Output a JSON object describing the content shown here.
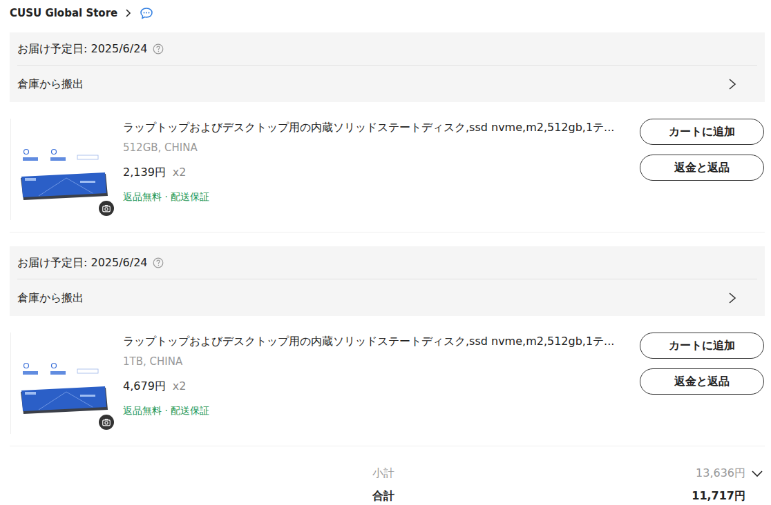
{
  "store": {
    "name": "CUSU Global Store"
  },
  "orders": [
    {
      "delivery_label": "お届け予定日: 2025/6/24",
      "status": "倉庫から搬出",
      "item": {
        "title": "ラップトップおよびデスクトップ用の内蔵ソリッドステートディスク,ssd nvme,m2,512gb,1テ...",
        "variant": "512GB, CHINA",
        "price": "2,139円",
        "quantity": "x2",
        "badges": "返品無料 · 配送保証",
        "buttons": [
          "カートに追加",
          "返金と返品"
        ]
      }
    },
    {
      "delivery_label": "お届け予定日: 2025/6/24",
      "status": "倉庫から搬出",
      "item": {
        "title": "ラップトップおよびデスクトップ用の内蔵ソリッドステートディスク,ssd nvme,m2,512gb,1テ...",
        "variant": "1TB, CHINA",
        "price": "4,679円",
        "quantity": "x2",
        "badges": "返品無料 · 配送保証",
        "buttons": [
          "カートに追加",
          "返金と返品"
        ]
      }
    }
  ],
  "summary": {
    "subtotal_label": "小計",
    "subtotal": "13,636円",
    "total_label": "合計",
    "total": "11,717円"
  }
}
